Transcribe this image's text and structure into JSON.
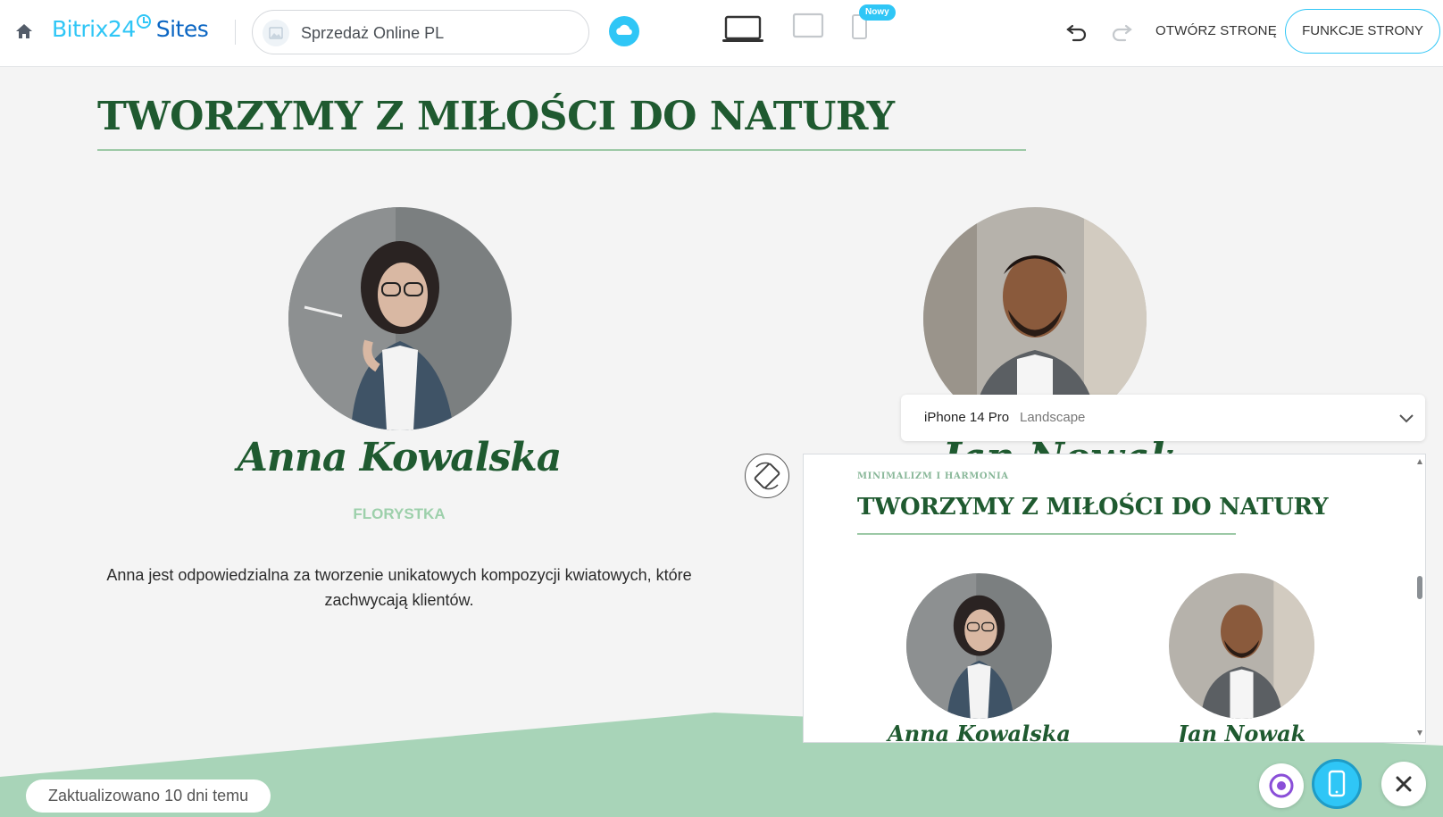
{
  "header": {
    "logo_brand": "Bitrix24",
    "logo_product": "Sites",
    "site_name": "Sprzedaż Online PL",
    "new_badge": "Nowy",
    "open_page_label": "OTWÓRZ STRONĘ",
    "page_functions_label": "FUNKCJE STRONY"
  },
  "page": {
    "title": "TWORZYMY Z MIŁOŚCI DO NATURY",
    "member_anna": {
      "name": "Anna Kowalska",
      "role": "FLORYSTKA",
      "description": "Anna jest odpowiedzialna za tworzenie unikatowych kompozycji kwiatowych, które zachwycają klientów."
    },
    "member_jan_partial": "Jan Nowak"
  },
  "preview": {
    "device_name": "iPhone 14 Pro",
    "device_orientation": "Landscape",
    "eyebrow": "MINIMALIZM I HARMONIA",
    "title": "TWORZYMY Z MIŁOŚCI DO NATURY",
    "name_1": "Anna Kowalska",
    "name_2": "Jan Nowak"
  },
  "footer": {
    "updated": "Zaktualizowano 10 dni temu"
  },
  "colors": {
    "accent": "#2fc6f6",
    "brand_dark": "#0b66c3",
    "title_green": "#1f5a30",
    "light_green": "#9dd0ab",
    "ground_green": "#a8d4b8"
  },
  "icons": [
    "home-icon",
    "cloud-icon",
    "desktop-icon",
    "tablet-icon",
    "mobile-icon",
    "undo-icon",
    "redo-icon",
    "rotate-icon",
    "chevron-down-icon",
    "ai-assistant-icon",
    "close-icon"
  ]
}
